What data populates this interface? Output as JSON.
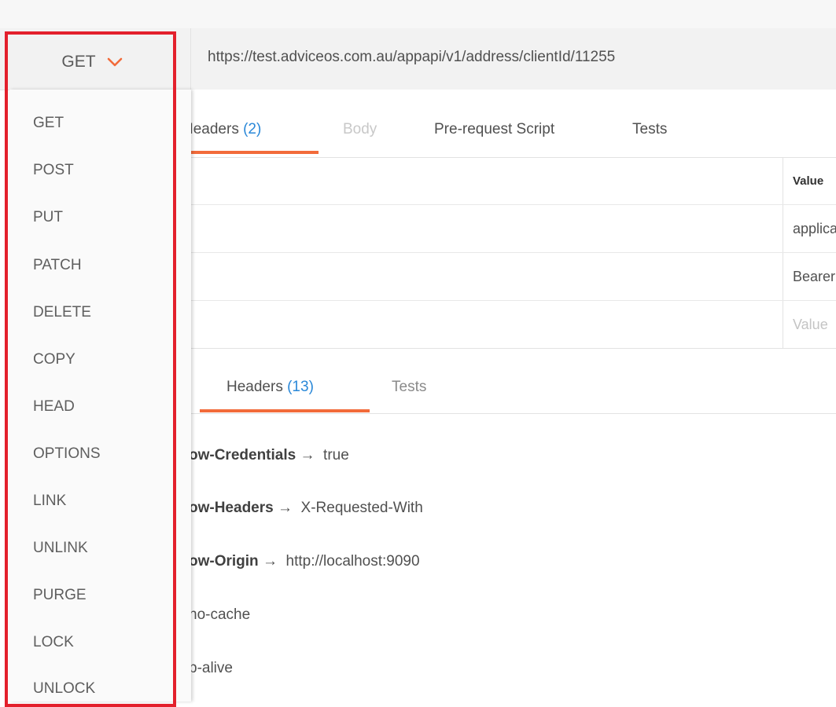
{
  "request": {
    "method": "GET",
    "url": "https://test.adviceos.com.au/appapi/v1/address/clientId/11255"
  },
  "request_tabs": [
    {
      "label": "Headers",
      "count": "(2)",
      "active": true
    },
    {
      "label": "Body",
      "count": "",
      "active": false
    },
    {
      "label": "Pre-request Script",
      "count": "",
      "active": false
    },
    {
      "label": "Tests",
      "count": "",
      "active": false
    }
  ],
  "headers_table": {
    "value_column_label": "Value",
    "rows": [
      {
        "value": "application/json"
      },
      {
        "value": "Bearer"
      }
    ],
    "new_value_placeholder": "Value"
  },
  "response_tabs": [
    {
      "label": "Headers",
      "count": "(13)",
      "active": true
    },
    {
      "label": "Tests",
      "count": "",
      "active": false
    }
  ],
  "response_headers": [
    {
      "key": "ow-Credentials",
      "value": "true"
    },
    {
      "key": "ow-Headers",
      "value": "X-Requested-With"
    },
    {
      "key": "ow-Origin",
      "value": "http://localhost:9090"
    },
    {
      "key": "",
      "value": "no-cache"
    },
    {
      "key": "",
      "value": "p-alive"
    }
  ],
  "arrow_glyph": "→",
  "method_options": [
    "GET",
    "POST",
    "PUT",
    "PATCH",
    "DELETE",
    "COPY",
    "HEAD",
    "OPTIONS",
    "LINK",
    "UNLINK",
    "PURGE",
    "LOCK",
    "UNLOCK"
  ],
  "colors": {
    "accent_orange": "#f26b3a",
    "count_blue": "#2a88d8",
    "highlight_red": "#e3202c"
  },
  "icons": {
    "method_dropdown": "chevron-down-icon"
  }
}
